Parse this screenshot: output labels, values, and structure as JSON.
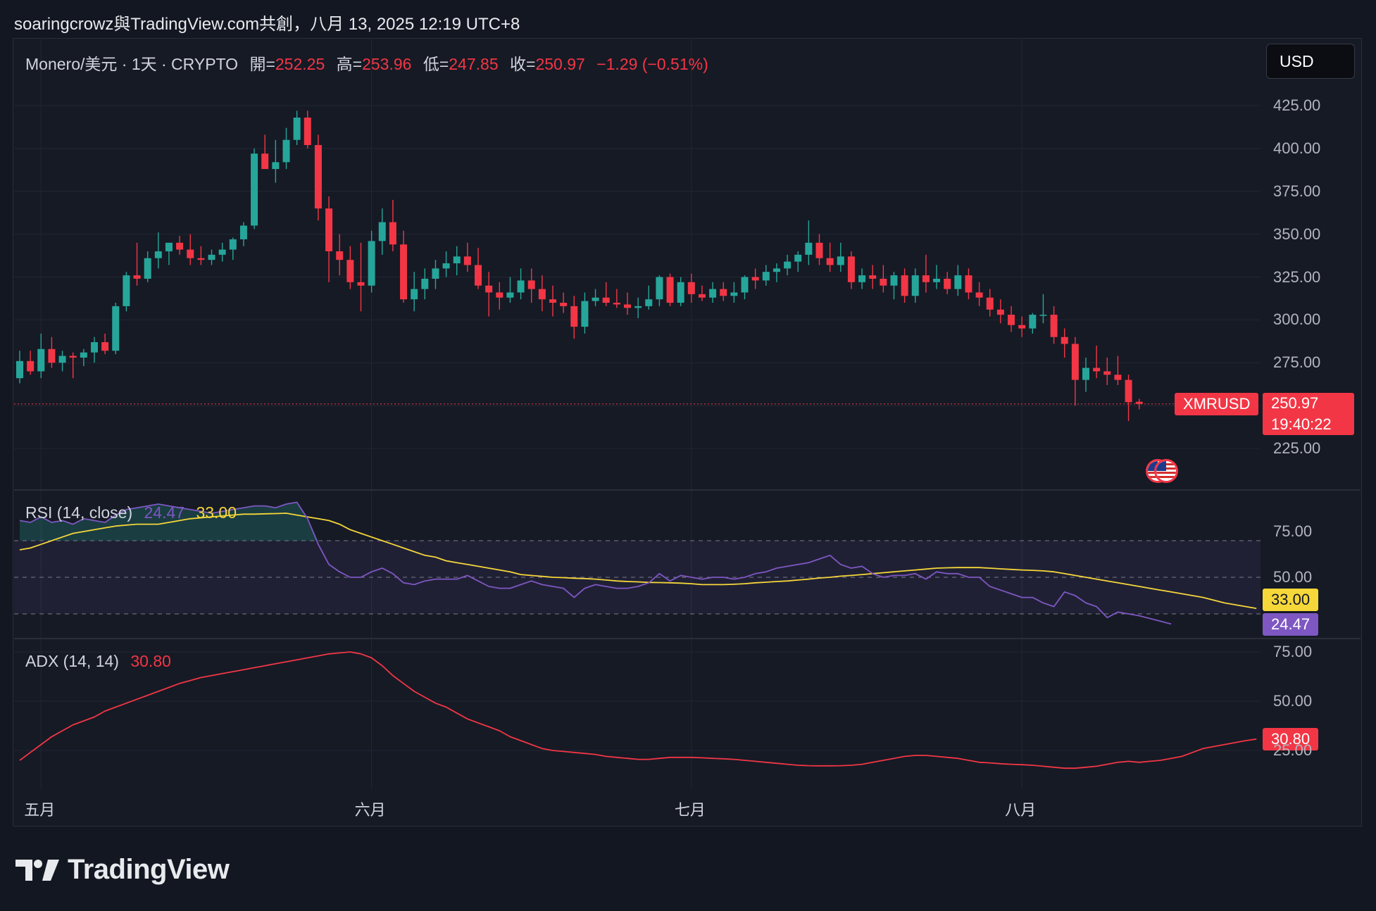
{
  "header": {
    "attribution": "soaringcrowz與TradingView.com共創，八月 13, 2025 12:19 UTC+8"
  },
  "legend": {
    "symbol": "Monero/美元 · 1天 · CRYPTO",
    "open_label": "開=",
    "open": "252.25",
    "high_label": "高=",
    "high": "253.96",
    "low_label": "低=",
    "low": "247.85",
    "close_label": "收=",
    "close": "250.97",
    "change": "−1.29 (−0.51%)"
  },
  "currency_button": "USD",
  "price_tag": {
    "ticker": "XMRUSD",
    "price": "250.97",
    "countdown": "19:40:22"
  },
  "rsi": {
    "label": "RSI (14, close)",
    "value": "24.47",
    "ma_value": "33.00"
  },
  "adx": {
    "label": "ADX (14, 14)",
    "value": "30.80"
  },
  "axes": {
    "price_ticks": [
      "425.00",
      "400.00",
      "375.00",
      "350.00",
      "325.00",
      "300.00",
      "275.00",
      "225.00"
    ],
    "rsi_ticks": [
      "75.00",
      "50.00"
    ],
    "adx_ticks": [
      "75.00",
      "50.00",
      "25.00"
    ],
    "months": [
      "五月",
      "六月",
      "七月",
      "八月"
    ]
  },
  "branding": {
    "wordmark": "TradingView"
  },
  "colors": {
    "up": "#26a69a",
    "down": "#f23645",
    "rsi": "#7e57c2",
    "rsi_ma": "#f5d73a",
    "adx": "#f23645",
    "background": "#161a25"
  },
  "chart_data": [
    {
      "type": "candlestick",
      "title": "Monero/美元 · 1天 · CRYPTO",
      "ylim": [
        195,
        440
      ],
      "x_start": "2025-04-29",
      "x_end": "2025-08-13",
      "ohlc": [
        [
          "2025-04-29",
          266,
          282,
          263,
          276
        ],
        [
          "2025-04-30",
          276,
          282,
          268,
          270
        ],
        [
          "2025-05-01",
          270,
          292,
          266,
          283
        ],
        [
          "2025-05-02",
          283,
          290,
          272,
          275
        ],
        [
          "2025-05-03",
          275,
          282,
          270,
          279
        ],
        [
          "2025-05-04",
          279,
          281,
          266,
          278
        ],
        [
          "2025-05-05",
          278,
          283,
          273,
          281
        ],
        [
          "2025-05-06",
          281,
          290,
          275,
          287
        ],
        [
          "2025-05-07",
          287,
          292,
          280,
          282
        ],
        [
          "2025-05-08",
          282,
          310,
          280,
          308
        ],
        [
          "2025-05-09",
          308,
          328,
          305,
          326
        ],
        [
          "2025-05-10",
          326,
          345,
          320,
          324
        ],
        [
          "2025-05-11",
          324,
          340,
          322,
          336
        ],
        [
          "2025-05-12",
          336,
          351,
          330,
          340
        ],
        [
          "2025-05-13",
          340,
          345,
          332,
          345
        ],
        [
          "2025-05-14",
          345,
          349,
          338,
          341
        ],
        [
          "2025-05-15",
          341,
          350,
          332,
          336
        ],
        [
          "2025-05-16",
          336,
          343,
          332,
          335
        ],
        [
          "2025-05-17",
          335,
          341,
          332,
          338
        ],
        [
          "2025-05-18",
          338,
          345,
          334,
          341
        ],
        [
          "2025-05-19",
          341,
          348,
          335,
          347
        ],
        [
          "2025-05-20",
          347,
          357,
          343,
          355
        ],
        [
          "2025-05-21",
          355,
          400,
          353,
          397
        ],
        [
          "2025-05-22",
          397,
          408,
          390,
          388
        ],
        [
          "2025-05-23",
          388,
          405,
          380,
          392
        ],
        [
          "2025-05-24",
          392,
          412,
          388,
          405
        ],
        [
          "2025-05-25",
          405,
          422,
          402,
          418
        ],
        [
          "2025-05-26",
          418,
          422,
          400,
          402
        ],
        [
          "2025-05-27",
          402,
          408,
          358,
          365
        ],
        [
          "2025-05-28",
          365,
          372,
          322,
          340
        ],
        [
          "2025-05-29",
          340,
          350,
          326,
          335
        ],
        [
          "2025-05-30",
          335,
          343,
          318,
          322
        ],
        [
          "2025-05-31",
          322,
          345,
          305,
          320
        ],
        [
          "2025-06-01",
          320,
          352,
          316,
          346
        ],
        [
          "2025-06-02",
          346,
          365,
          338,
          357
        ],
        [
          "2025-06-03",
          357,
          370,
          340,
          344
        ],
        [
          "2025-06-04",
          344,
          352,
          310,
          312
        ],
        [
          "2025-06-05",
          312,
          328,
          305,
          318
        ],
        [
          "2025-06-06",
          318,
          330,
          312,
          324
        ],
        [
          "2025-06-07",
          324,
          335,
          318,
          330
        ],
        [
          "2025-06-08",
          330,
          340,
          325,
          333
        ],
        [
          "2025-06-09",
          333,
          343,
          326,
          337
        ],
        [
          "2025-06-10",
          337,
          345,
          328,
          332
        ],
        [
          "2025-06-11",
          332,
          342,
          318,
          320
        ],
        [
          "2025-06-12",
          320,
          328,
          302,
          316
        ],
        [
          "2025-06-13",
          316,
          322,
          306,
          313
        ],
        [
          "2025-06-14",
          313,
          325,
          310,
          316
        ],
        [
          "2025-06-15",
          316,
          330,
          312,
          323
        ],
        [
          "2025-06-16",
          323,
          330,
          310,
          318
        ],
        [
          "2025-06-17",
          318,
          326,
          305,
          312
        ],
        [
          "2025-06-18",
          312,
          320,
          302,
          310
        ],
        [
          "2025-06-19",
          310,
          316,
          304,
          308
        ],
        [
          "2025-06-20",
          308,
          314,
          289,
          296
        ],
        [
          "2025-06-21",
          296,
          316,
          292,
          311
        ],
        [
          "2025-06-22",
          311,
          318,
          308,
          313
        ],
        [
          "2025-06-23",
          313,
          322,
          308,
          310
        ],
        [
          "2025-06-24",
          310,
          318,
          307,
          309
        ],
        [
          "2025-06-25",
          309,
          316,
          303,
          307
        ],
        [
          "2025-06-26",
          307,
          313,
          301,
          308
        ],
        [
          "2025-06-27",
          308,
          320,
          306,
          312
        ],
        [
          "2025-06-28",
          312,
          326,
          308,
          325
        ],
        [
          "2025-06-29",
          325,
          327,
          308,
          310
        ],
        [
          "2025-06-30",
          310,
          325,
          308,
          322
        ],
        [
          "2025-07-01",
          322,
          327,
          310,
          315
        ],
        [
          "2025-07-02",
          315,
          320,
          311,
          313
        ],
        [
          "2025-07-03",
          313,
          322,
          310,
          318
        ],
        [
          "2025-07-04",
          318,
          322,
          311,
          314
        ],
        [
          "2025-07-05",
          314,
          322,
          310,
          316
        ],
        [
          "2025-07-06",
          316,
          326,
          312,
          325
        ],
        [
          "2025-07-07",
          325,
          330,
          318,
          323
        ],
        [
          "2025-07-08",
          323,
          332,
          320,
          328
        ],
        [
          "2025-07-09",
          328,
          333,
          322,
          330
        ],
        [
          "2025-07-10",
          330,
          338,
          326,
          334
        ],
        [
          "2025-07-11",
          334,
          340,
          328,
          338
        ],
        [
          "2025-07-12",
          338,
          358,
          332,
          345
        ],
        [
          "2025-07-13",
          345,
          350,
          332,
          336
        ],
        [
          "2025-07-14",
          336,
          345,
          328,
          332
        ],
        [
          "2025-07-15",
          332,
          345,
          328,
          337
        ],
        [
          "2025-07-16",
          337,
          340,
          318,
          322
        ],
        [
          "2025-07-17",
          322,
          330,
          318,
          326
        ],
        [
          "2025-07-18",
          326,
          332,
          318,
          324
        ],
        [
          "2025-07-19",
          324,
          332,
          316,
          320
        ],
        [
          "2025-07-20",
          320,
          328,
          312,
          326
        ],
        [
          "2025-07-21",
          326,
          330,
          310,
          314
        ],
        [
          "2025-07-22",
          314,
          330,
          310,
          326
        ],
        [
          "2025-07-23",
          326,
          338,
          316,
          322
        ],
        [
          "2025-07-24",
          322,
          332,
          318,
          324
        ],
        [
          "2025-07-25",
          324,
          328,
          315,
          318
        ],
        [
          "2025-07-26",
          318,
          332,
          314,
          326
        ],
        [
          "2025-07-27",
          326,
          330,
          312,
          316
        ],
        [
          "2025-07-28",
          316,
          322,
          308,
          313
        ],
        [
          "2025-07-29",
          313,
          318,
          302,
          306
        ],
        [
          "2025-07-30",
          306,
          312,
          298,
          303
        ],
        [
          "2025-07-31",
          303,
          308,
          293,
          297
        ],
        [
          "2025-08-01",
          297,
          302,
          290,
          295
        ],
        [
          "2025-08-02",
          295,
          304,
          292,
          303
        ],
        [
          "2025-08-03",
          303,
          315,
          298,
          303
        ],
        [
          "2025-08-04",
          303,
          308,
          286,
          290
        ],
        [
          "2025-08-05",
          290,
          295,
          278,
          286
        ],
        [
          "2025-08-06",
          286,
          290,
          250,
          265
        ],
        [
          "2025-08-07",
          265,
          278,
          258,
          272
        ],
        [
          "2025-08-08",
          272,
          285,
          266,
          270
        ],
        [
          "2025-08-09",
          270,
          278,
          262,
          268
        ],
        [
          "2025-08-10",
          268,
          279,
          262,
          265
        ],
        [
          "2025-08-11",
          265,
          268,
          241,
          252
        ],
        [
          "2025-08-12",
          252.25,
          253.96,
          247.85,
          250.97
        ]
      ],
      "last_price": 250.97,
      "legend": "Monero/美元"
    },
    {
      "type": "line",
      "title": "RSI (14, close)",
      "ylim": [
        12,
        96
      ],
      "x_start": "2025-04-29",
      "x_end": "2025-08-12",
      "bands": [
        70,
        50,
        30
      ],
      "series": [
        {
          "name": "RSI",
          "color": "#7e57c2",
          "values": [
            81,
            80,
            83,
            80,
            81,
            79,
            82,
            81,
            80,
            84,
            87,
            88,
            89,
            90,
            89,
            88,
            87,
            86,
            85,
            86,
            87,
            88,
            89,
            89,
            88,
            90,
            91,
            82,
            68,
            57,
            53,
            50,
            50,
            53,
            55,
            52,
            47,
            46,
            48,
            49,
            49,
            49,
            51,
            48,
            45,
            44,
            44,
            46,
            48,
            46,
            45,
            44,
            39,
            44,
            46,
            45,
            44,
            44,
            45,
            47,
            52,
            48,
            51,
            50,
            49,
            50,
            50,
            49,
            50,
            52,
            53,
            55,
            56,
            57,
            58,
            60,
            62,
            57,
            55,
            56,
            52,
            50,
            51,
            51,
            52,
            49,
            53,
            52,
            52,
            50,
            50,
            45,
            43,
            41,
            39,
            39,
            36,
            34,
            42,
            40,
            36,
            34,
            28,
            31,
            30,
            29,
            27.5,
            26,
            24.47
          ]
        },
        {
          "name": "RSI-based MA",
          "color": "#f5d73a",
          "values": [
            65,
            66,
            68,
            70,
            72,
            74,
            75,
            76,
            77,
            78,
            78.5,
            79,
            79,
            79,
            80,
            81,
            82,
            82.5,
            83,
            83.5,
            84,
            84.5,
            84.5,
            84.7,
            84.8,
            85,
            84,
            83,
            82,
            81,
            79,
            76,
            74,
            72,
            70,
            68,
            66,
            64,
            62,
            61,
            59,
            58,
            57,
            56,
            55,
            54,
            53,
            51.5,
            51,
            50.5,
            50,
            49.8,
            49.5,
            49.3,
            49,
            48.5,
            48,
            47.7,
            47.5,
            47.2,
            47.1,
            47,
            46.8,
            46.5,
            46,
            46,
            46,
            46.2,
            46.5,
            47,
            47.3,
            47.7,
            48,
            48.5,
            49,
            49.6,
            50,
            50.6,
            51,
            51.5,
            52,
            52.5,
            53,
            53.5,
            54,
            54.5,
            55,
            55.2,
            55.3,
            55.3,
            55.3,
            55,
            54.6,
            54.3,
            54,
            53.8,
            53.5,
            53,
            52,
            51,
            50,
            49,
            48,
            47,
            46,
            45,
            44,
            43,
            42,
            41,
            40,
            39,
            37.5,
            36,
            35,
            34,
            33
          ]
        }
      ]
    },
    {
      "type": "line",
      "title": "ADX (14, 14)",
      "ylim": [
        0,
        80
      ],
      "x_start": "2025-04-29",
      "x_end": "2025-08-12",
      "series": [
        {
          "name": "ADX",
          "color": "#f23645",
          "values": [
            20,
            24,
            28,
            32,
            35,
            38,
            40,
            42,
            45,
            47,
            49,
            51,
            53,
            55,
            57,
            59,
            60.5,
            62,
            63,
            64,
            65,
            66,
            67,
            68,
            69,
            70,
            71,
            72,
            73,
            74,
            74.5,
            75,
            74,
            72,
            68,
            63,
            59,
            55,
            52,
            49,
            47,
            44,
            41,
            39,
            37,
            35,
            32,
            30,
            28,
            26,
            25,
            24.5,
            24,
            23.5,
            23,
            22,
            21.5,
            21,
            20.5,
            20.5,
            21,
            21.5,
            21.5,
            21.5,
            21.3,
            21,
            20.8,
            20.5,
            20,
            19.5,
            19,
            18.5,
            18,
            17.5,
            17.3,
            17.2,
            17.2,
            17.3,
            17.5,
            18,
            19,
            20,
            21,
            22,
            22.5,
            22.5,
            22,
            21.5,
            21,
            20,
            19,
            18.7,
            18.3,
            18,
            17.8,
            17.5,
            17,
            16.5,
            16,
            16,
            16.5,
            17,
            18,
            19,
            19.5,
            19,
            19.5,
            20,
            21,
            22,
            24,
            26,
            27,
            28,
            29,
            30,
            30.8
          ]
        }
      ]
    }
  ]
}
